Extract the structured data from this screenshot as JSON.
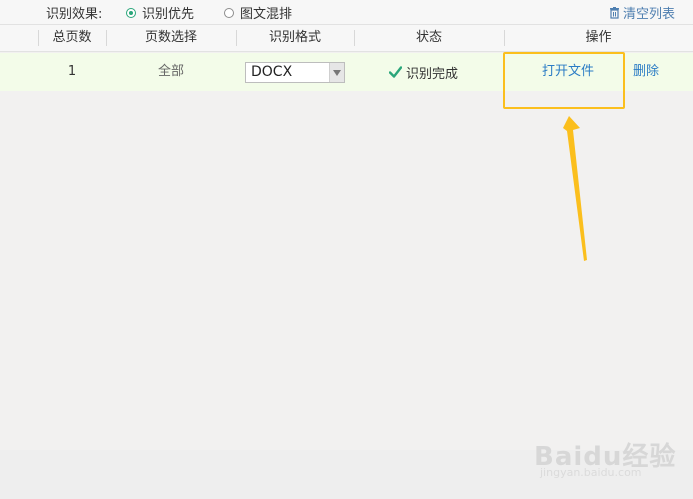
{
  "toolbar": {
    "effect_label": "识别效果:",
    "options": [
      "识别优先",
      "图文混排"
    ],
    "selected_option": "识别优先",
    "clear_label": "清空列表"
  },
  "table": {
    "headers": [
      "总页数",
      "页数选择",
      "识别格式",
      "状态",
      "操作"
    ],
    "rows": [
      {
        "pages": "1",
        "page_selection": "全部",
        "format": "DOCX",
        "status": "识别完成",
        "open_label": "打开文件",
        "delete_label": "删除"
      }
    ]
  },
  "watermark": {
    "brand": "Baidu经验",
    "url": "jingyan.baidu.com"
  },
  "colors": {
    "accent_green": "#2aa67a",
    "link_blue": "#2b7cc5",
    "row_highlight": "#f3fce9",
    "annotation_yellow": "#fbbf1d"
  }
}
